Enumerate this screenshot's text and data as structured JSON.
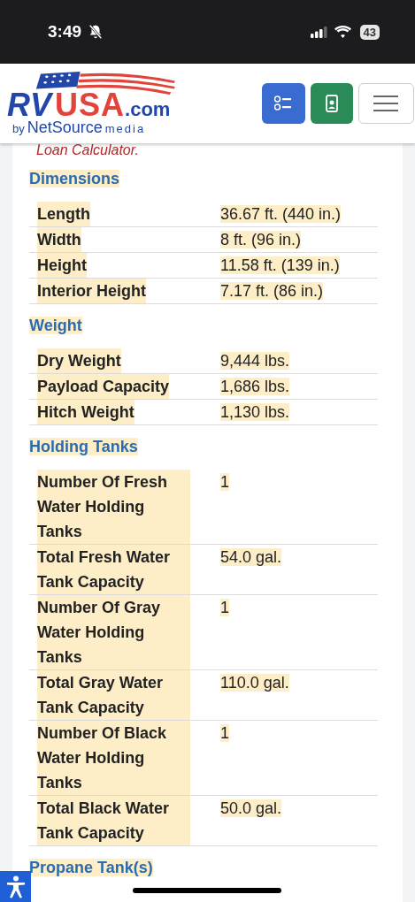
{
  "status_bar": {
    "time": "3:49",
    "battery": "43"
  },
  "header": {
    "logo": {
      "brand_rv": "RV",
      "brand_usa": "USA",
      "domain": ".com",
      "byline_by": "by",
      "byline_name": "NetSource",
      "byline_media": "media"
    }
  },
  "intro_text": "Loan Calculator.",
  "sections": [
    {
      "title": "Dimensions",
      "rows": [
        {
          "label": "Length",
          "value": "36.67 ft. (440 in.)"
        },
        {
          "label": "Width",
          "value": "8 ft. (96 in.)"
        },
        {
          "label": "Height",
          "value": "11.58 ft. (139 in.)"
        },
        {
          "label": "Interior Height",
          "value": "7.17 ft. (86 in.)"
        }
      ]
    },
    {
      "title": "Weight",
      "rows": [
        {
          "label": "Dry Weight",
          "value": "9,444 lbs."
        },
        {
          "label": "Payload Capacity",
          "value": "1,686 lbs."
        },
        {
          "label": "Hitch Weight",
          "value": "1,130 lbs."
        }
      ]
    },
    {
      "title": "Holding Tanks",
      "rows": [
        {
          "label": "Number Of Fresh Water Holding Tanks",
          "value": "1"
        },
        {
          "label": "Total Fresh Water Tank Capacity",
          "value": "54.0 gal."
        },
        {
          "label": "Number Of Gray Water Holding Tanks",
          "value": "1"
        },
        {
          "label": "Total Gray Water Tank Capacity",
          "value": "110.0 gal."
        },
        {
          "label": "Number Of Black Water Holding Tanks",
          "value": "1"
        },
        {
          "label": "Total Black Water Tank Capacity",
          "value": "50.0 gal."
        }
      ]
    },
    {
      "title": "Propane Tank(s)"
    }
  ]
}
